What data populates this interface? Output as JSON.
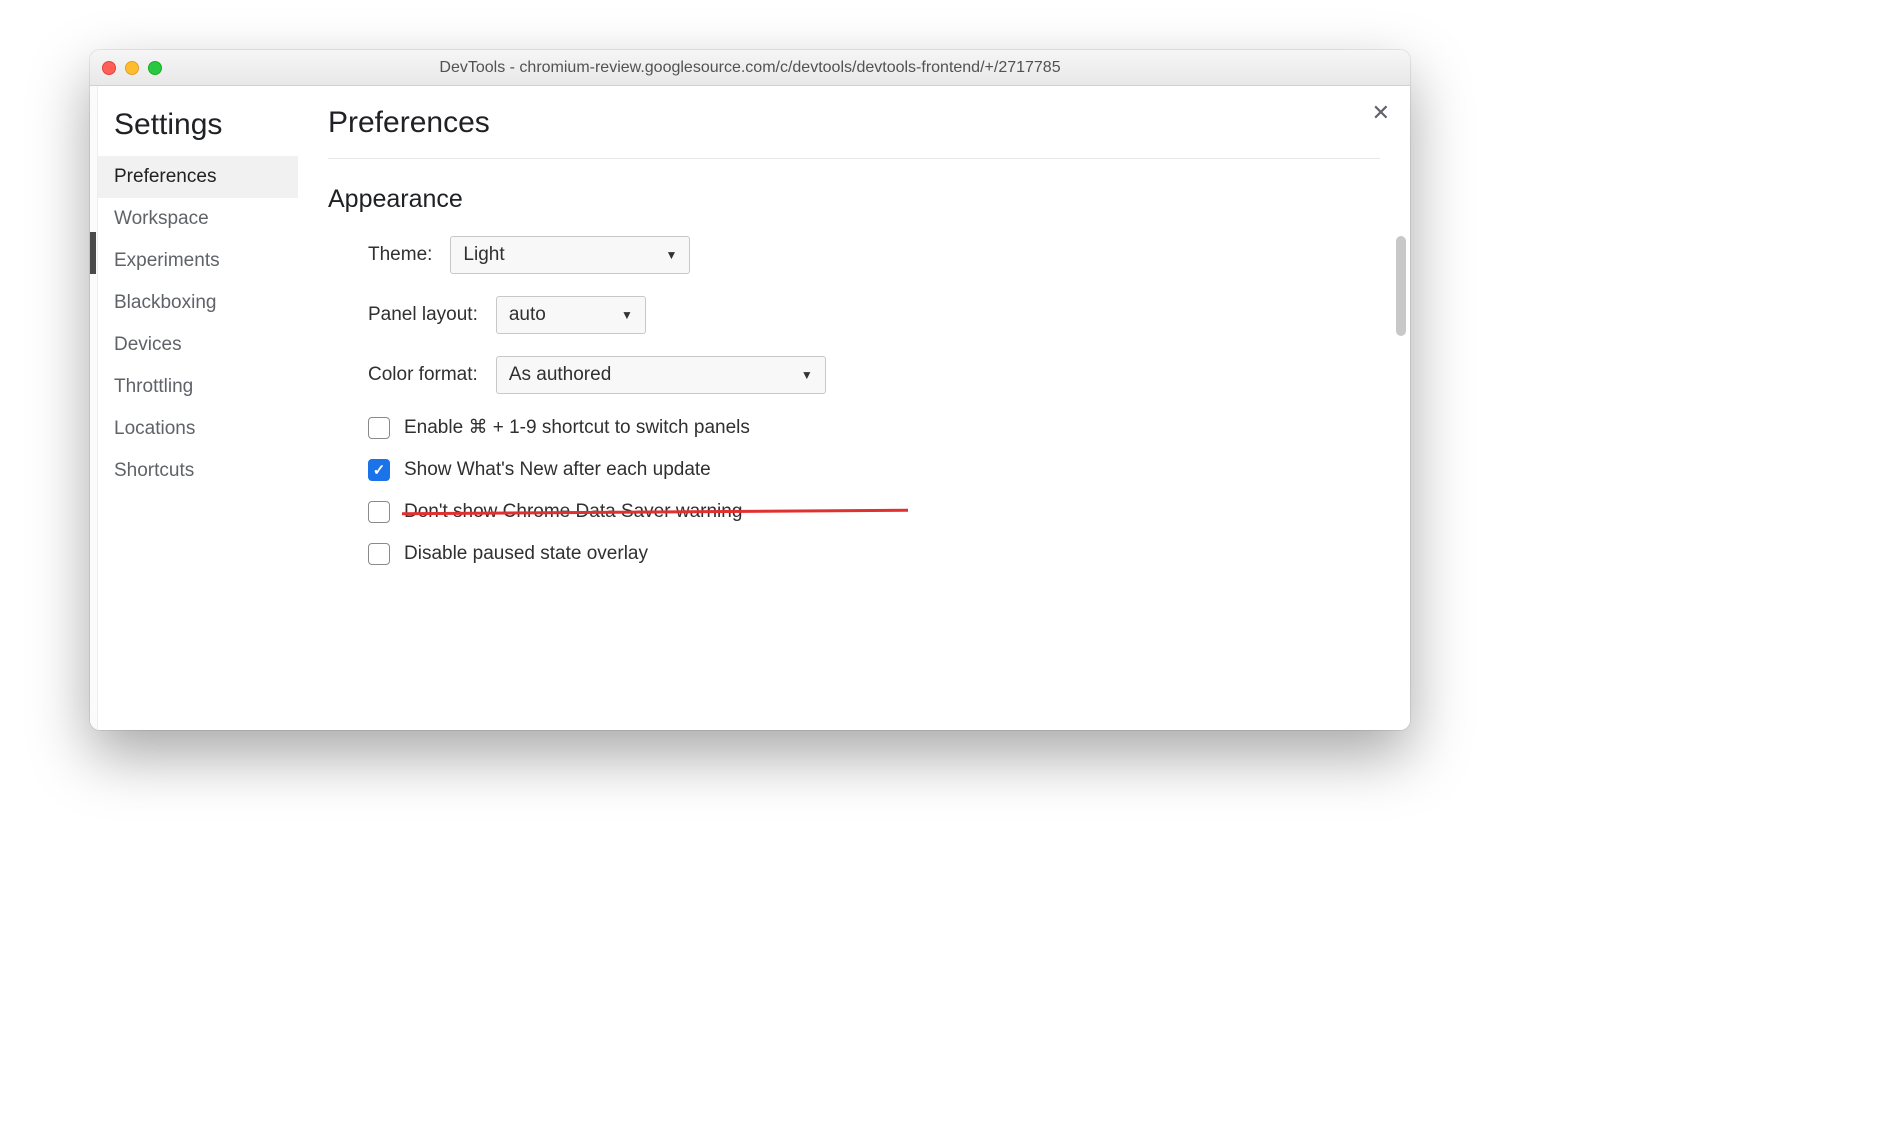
{
  "window": {
    "title": "DevTools - chromium-review.googlesource.com/c/devtools/devtools-frontend/+/2717785"
  },
  "sidebar": {
    "title": "Settings",
    "items": [
      {
        "label": "Preferences",
        "active": true
      },
      {
        "label": "Workspace"
      },
      {
        "label": "Experiments"
      },
      {
        "label": "Blackboxing"
      },
      {
        "label": "Devices"
      },
      {
        "label": "Throttling"
      },
      {
        "label": "Locations"
      },
      {
        "label": "Shortcuts"
      }
    ]
  },
  "main": {
    "title": "Preferences",
    "section_title": "Appearance",
    "close_label": "✕",
    "theme": {
      "label": "Theme:",
      "value": "Light"
    },
    "panel_layout": {
      "label": "Panel layout:",
      "value": "auto"
    },
    "color_format": {
      "label": "Color format:",
      "value": "As authored"
    },
    "checkboxes": [
      {
        "label": "Enable ⌘ + 1-9 shortcut to switch panels",
        "checked": false,
        "struck": false
      },
      {
        "label": "Show What's New after each update",
        "checked": true,
        "struck": false
      },
      {
        "label": "Don't show Chrome Data Saver warning",
        "checked": false,
        "struck": true
      },
      {
        "label": "Disable paused state overlay",
        "checked": false,
        "struck": false
      }
    ]
  }
}
